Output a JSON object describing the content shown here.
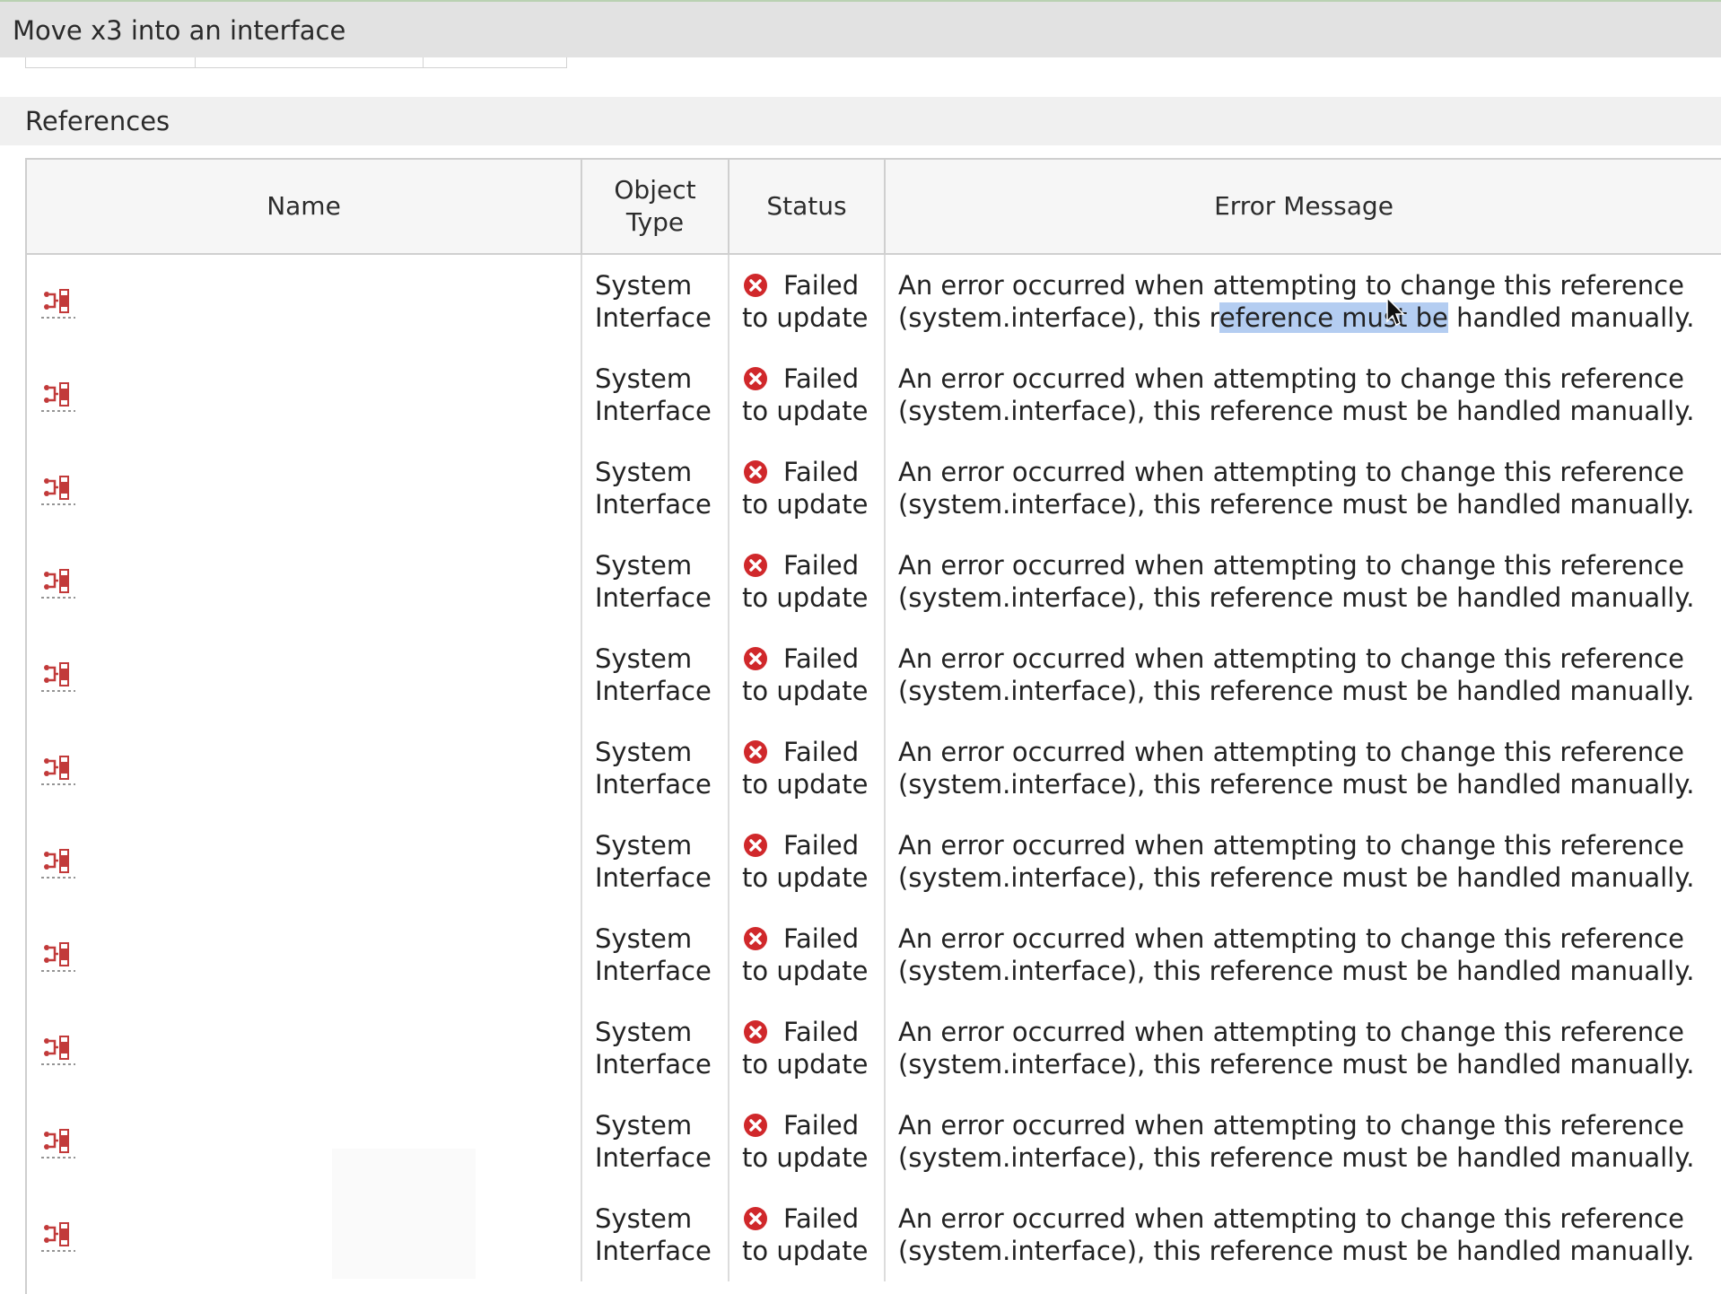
{
  "window": {
    "title": "Move x3 into an interface"
  },
  "section": {
    "title": "References"
  },
  "table": {
    "headers": {
      "name": "Name",
      "object_type_line1": "Object",
      "object_type_line2": "Type",
      "status": "Status",
      "error_message": "Error Message"
    },
    "rows": [
      {
        "icon": "system-interface-icon",
        "type_line1": "System",
        "type_line2": "Interface",
        "status_line1": "Failed",
        "status_line2": "to update",
        "error_line1": "An error occurred when attempting to change this reference",
        "error_line2": "(system.interface), this reference must be handled manually."
      },
      {
        "icon": "system-interface-icon",
        "type_line1": "System",
        "type_line2": "Interface",
        "status_line1": "Failed",
        "status_line2": "to update",
        "error_line1": "An error occurred when attempting to change this reference",
        "error_line2": "(system.interface), this reference must be handled manually."
      },
      {
        "icon": "system-interface-icon",
        "type_line1": "System",
        "type_line2": "Interface",
        "status_line1": "Failed",
        "status_line2": "to update",
        "error_line1": "An error occurred when attempting to change this reference",
        "error_line2": "(system.interface), this reference must be handled manually."
      },
      {
        "icon": "system-interface-icon",
        "type_line1": "System",
        "type_line2": "Interface",
        "status_line1": "Failed",
        "status_line2": "to update",
        "error_line1": "An error occurred when attempting to change this reference",
        "error_line2": "(system.interface), this reference must be handled manually."
      },
      {
        "icon": "system-interface-icon",
        "type_line1": "System",
        "type_line2": "Interface",
        "status_line1": "Failed",
        "status_line2": "to update",
        "error_line1": "An error occurred when attempting to change this reference",
        "error_line2": "(system.interface), this reference must be handled manually."
      },
      {
        "icon": "system-interface-icon",
        "type_line1": "System",
        "type_line2": "Interface",
        "status_line1": "Failed",
        "status_line2": "to update",
        "error_line1": "An error occurred when attempting to change this reference",
        "error_line2": "(system.interface), this reference must be handled manually."
      },
      {
        "icon": "system-interface-icon",
        "type_line1": "System",
        "type_line2": "Interface",
        "status_line1": "Failed",
        "status_line2": "to update",
        "error_line1": "An error occurred when attempting to change this reference",
        "error_line2": "(system.interface), this reference must be handled manually."
      },
      {
        "icon": "system-interface-icon",
        "type_line1": "System",
        "type_line2": "Interface",
        "status_line1": "Failed",
        "status_line2": "to update",
        "error_line1": "An error occurred when attempting to change this reference",
        "error_line2": "(system.interface), this reference must be handled manually."
      },
      {
        "icon": "system-interface-icon",
        "type_line1": "System",
        "type_line2": "Interface",
        "status_line1": "Failed",
        "status_line2": "to update",
        "error_line1": "An error occurred when attempting to change this reference",
        "error_line2": "(system.interface), this reference must be handled manually."
      },
      {
        "icon": "system-interface-icon",
        "type_line1": "System",
        "type_line2": "Interface",
        "status_line1": "Failed",
        "status_line2": "to update",
        "error_line1": "An error occurred when attempting to change this reference",
        "error_line2": "(system.interface), this reference must be handled manually."
      },
      {
        "icon": "system-interface-icon",
        "type_line1": "System",
        "type_line2": "Interface",
        "status_line1": "Failed",
        "status_line2": "to update",
        "error_line1": "An error occurred when attempting to change this reference",
        "error_line2": "(system.interface), this reference must be handled manually."
      }
    ]
  },
  "selection": {
    "row": 0,
    "text": "eference must be"
  },
  "colors": {
    "status_error": "#d0282b",
    "icon_red": "#c23a3a",
    "selection": "#b4cdf1"
  }
}
